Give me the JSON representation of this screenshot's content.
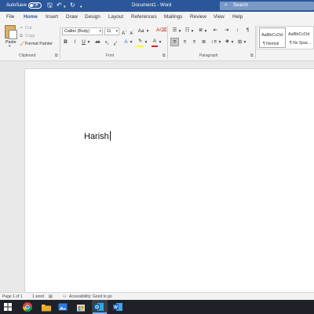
{
  "titlebar": {
    "autosave_label": "AutoSave",
    "autosave_state": "Off",
    "document_title": "Document1 - Word",
    "search_placeholder": "Search"
  },
  "menu": {
    "tabs": [
      "File",
      "Home",
      "Insert",
      "Draw",
      "Design",
      "Layout",
      "References",
      "Mailings",
      "Review",
      "View",
      "Help"
    ],
    "active": "Home"
  },
  "ribbon": {
    "clipboard": {
      "paste_label": "Paste",
      "cut_label": "Cut",
      "copy_label": "Copy",
      "format_painter_label": "Format Painter",
      "group_label": "Clipboard"
    },
    "font": {
      "font_name": "Calibri (Body)",
      "font_size": "11",
      "group_label": "Font",
      "highlight_color": "#ffff00",
      "font_color": "#e02020"
    },
    "paragraph": {
      "group_label": "Paragraph"
    },
    "styles": {
      "tiles": [
        {
          "sample": "AaBbCcDd",
          "name": "¶ Normal"
        },
        {
          "sample": "AaBbCcDd",
          "name": "¶ No Spac..."
        }
      ]
    }
  },
  "document": {
    "text": "Harish"
  },
  "statusbar": {
    "page": "Page 1 of 1",
    "words": "1 word",
    "accessibility": "Accessibility: Good to go"
  },
  "taskbar": {
    "icons": [
      "windows-icon",
      "chrome-icon",
      "file-explorer-icon",
      "photos-icon",
      "store-icon",
      "outlook-icon",
      "word-icon"
    ]
  },
  "colors": {
    "word_blue": "#2b579a"
  }
}
